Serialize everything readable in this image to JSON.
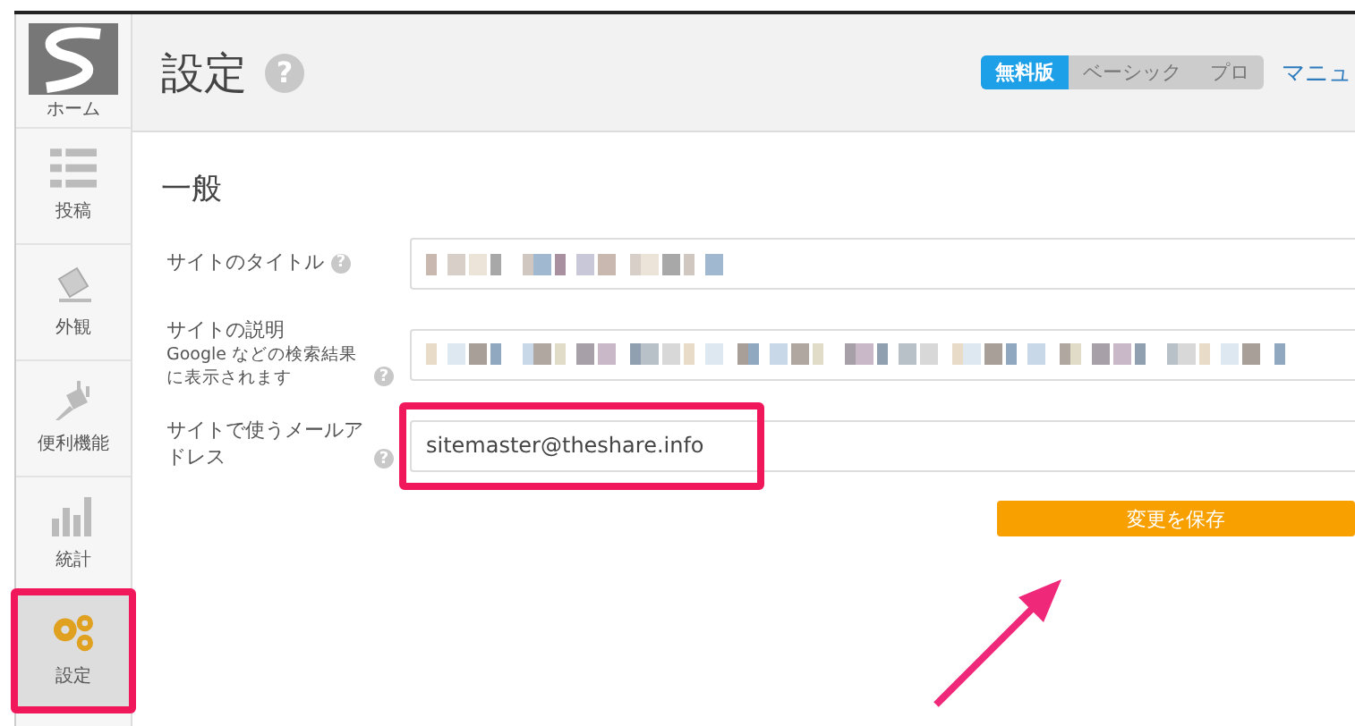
{
  "sidebar": {
    "items": [
      {
        "label": "ホーム",
        "selected": false,
        "highlighted": false
      },
      {
        "label": "投稿",
        "selected": false,
        "highlighted": false
      },
      {
        "label": "外観",
        "selected": false,
        "highlighted": false
      },
      {
        "label": "便利機能",
        "selected": false,
        "highlighted": false
      },
      {
        "label": "統計",
        "selected": false,
        "highlighted": false
      },
      {
        "label": "設定",
        "selected": true,
        "highlighted": true
      }
    ]
  },
  "header": {
    "title": "設定",
    "help": "?",
    "plans": [
      {
        "label": "無料版",
        "selected": true
      },
      {
        "label": "ベーシック",
        "selected": false
      },
      {
        "label": "プロ",
        "selected": false
      }
    ],
    "manual_link": "マニュ"
  },
  "section": {
    "title": "一般",
    "fields": [
      {
        "label": "サイトのタイトル",
        "help": "?",
        "value_obscured": true,
        "highlighted": false
      },
      {
        "label": "サイトの説明",
        "hint": "Google などの検索結果に表示されます",
        "help": "?",
        "value_obscured": true,
        "highlighted": false
      },
      {
        "label": "サイトで使うメールアドレス",
        "help": "?",
        "value": "sitemaster@theshare.info",
        "value_obscured": false,
        "highlighted": true
      }
    ]
  },
  "save_button": "変更を保存",
  "annotation_arrow": true
}
